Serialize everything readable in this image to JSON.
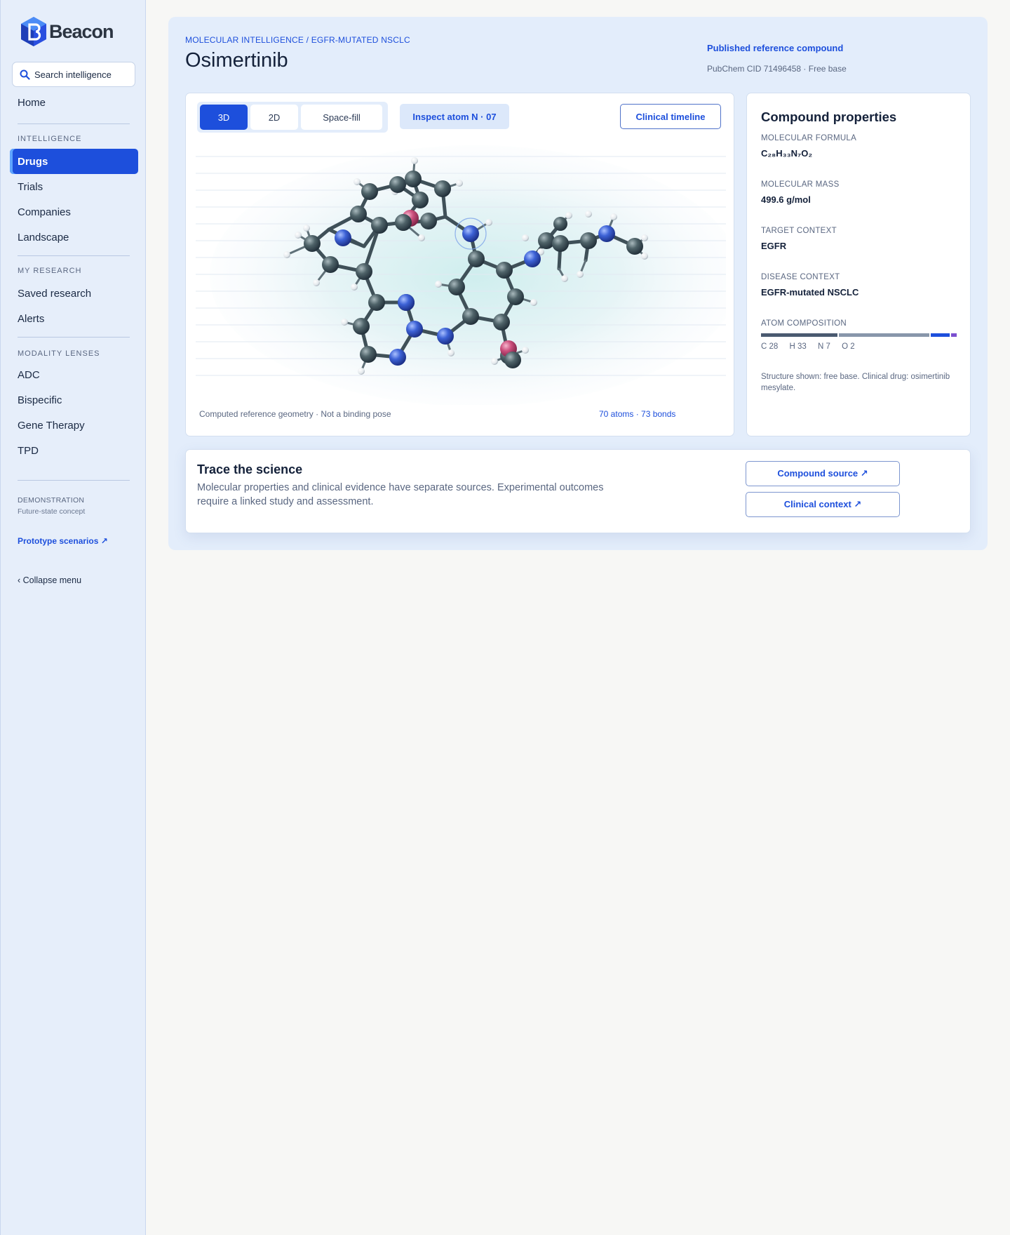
{
  "app": {
    "name": "Beacon"
  },
  "sidebar": {
    "search_label": "Search intelligence",
    "home": "Home",
    "sections": {
      "intelligence": "INTELLIGENCE",
      "my_research": "MY RESEARCH",
      "modality": "MODALITY LENSES"
    },
    "intelligence_items": [
      "Drugs",
      "Trials",
      "Companies",
      "Landscape"
    ],
    "research_items": [
      "Saved research",
      "Alerts"
    ],
    "modality_items": [
      "ADC",
      "Bispecific",
      "Gene Therapy",
      "TPD"
    ],
    "demo_label": "DEMONSTRATION",
    "demo_sub": "Future-state concept",
    "prototype_link": "Prototype scenarios ↗",
    "collapse": "‹  Collapse menu",
    "accent": "#1d4fdc"
  },
  "header": {
    "breadcrumb": "MOLECULAR INTELLIGENCE / EGFR-MUTATED NSCLC",
    "title": "Osimertinib",
    "published": "Published reference compound",
    "pubchem": "PubChem CID 71496458 · Free base"
  },
  "viewer": {
    "modes": [
      "3D",
      "2D",
      "Space-fill"
    ],
    "active_mode": "3D",
    "inspect": "Inspect atom N · 07",
    "timeline": "Clinical timeline",
    "footer_left": "Computed reference geometry · Not a binding pose",
    "footer_right": "70 atoms · 73 bonds"
  },
  "properties": {
    "title": "Compound properties",
    "formula_label": "MOLECULAR FORMULA",
    "formula": "C₂₈H₃₃N₇O₂",
    "mass_label": "MOLECULAR MASS",
    "mass": "499.6 g/mol",
    "target_label": "TARGET CONTEXT",
    "target": "EGFR",
    "disease_label": "DISEASE CONTEXT",
    "disease": "EGFR-mutated NSCLC",
    "composition_label": "ATOM COMPOSITION",
    "composition": [
      {
        "label": "C 28",
        "count": 28,
        "color": "#4a5a70"
      },
      {
        "label": "H 33",
        "count": 33,
        "color": "#8896aa"
      },
      {
        "label": "N 7",
        "count": 7,
        "color": "#1d4fdc"
      },
      {
        "label": "O 2",
        "count": 2,
        "color": "#7b4fd0"
      }
    ],
    "note": "Structure shown: free base. Clinical drug: osimertinib mesylate."
  },
  "trace": {
    "title": "Trace the science",
    "description": "Molecular properties and clinical evidence have separate sources. Experimental outcomes require a linked study and assessment.",
    "compound_source": "Compound source  ↗",
    "clinical_context": "Clinical context  ↗"
  }
}
